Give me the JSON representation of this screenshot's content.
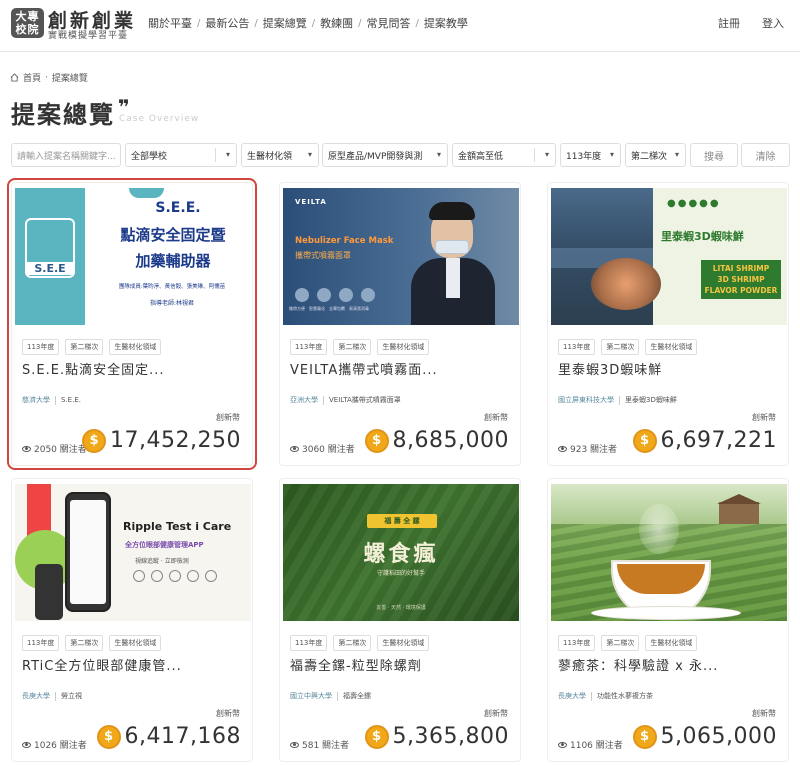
{
  "logo": {
    "box_text": "大專校院",
    "title": "創新創業",
    "subtitle": "實戰模擬學習平臺"
  },
  "nav": [
    "關於平臺",
    "最新公告",
    "提案總覽",
    "教練團",
    "常見問答",
    "提案教學"
  ],
  "auth": {
    "register": "註冊",
    "login": "登入"
  },
  "breadcrumb": {
    "home": "首頁",
    "sep": "·",
    "current": "提案總覽"
  },
  "page": {
    "title": "提案總覽",
    "quote": "❞",
    "subtitle": "Case Overview"
  },
  "filters": {
    "search_placeholder": "請輸入提案名稱關鍵字...",
    "school": "全部學校",
    "field": "生醫材化領",
    "stage": "原型產品/MVP開發與測",
    "sort": "金額高至低",
    "year": "113年度",
    "batch": "第二梯次",
    "search_button": "搜尋",
    "clear_button": "清除"
  },
  "currency_label": "創新幣",
  "coin_glyph": "$",
  "cards": [
    {
      "tags": [
        "113年度",
        "第二梯次",
        "生醫材化領域"
      ],
      "title": "S.E.E.點滴安全固定...",
      "school": "慈濟大學",
      "team": "S.E.E.",
      "followers": "2050 關注者",
      "amount": "17,452,250",
      "thumb": {
        "title1": "S.E.E.",
        "title2": "點滴安全固定暨",
        "title3": "加藥輔助器",
        "members": "團隊成員:葉昀淨、黃信毅、張美琳、阿儒苗",
        "advisor": "指導老師:林視君",
        "logo": "S.E.E"
      }
    },
    {
      "tags": [
        "113年度",
        "第二梯次",
        "生醫材化領域"
      ],
      "title": "VEILTA攜帶式噴霧面...",
      "school": "亞洲大學",
      "team": "VEILTA攜帶式噴霧面罩",
      "followers": "3060 關注者",
      "amount": "8,685,000",
      "thumb": {
        "brand": "VEILTA",
        "title_en": "Nebulizer Face Mask",
        "title_zh": "攜帶式噴霧面罩",
        "icons": [
          "攜帶方便",
          "智慧霧化",
          "全罩包覆",
          "易清潔消毒"
        ]
      }
    },
    {
      "tags": [
        "113年度",
        "第二梯次",
        "生醫材化領域"
      ],
      "title": "里泰蝦3D蝦味鮮",
      "school": "國立屏東科技大學",
      "team": "里泰蝦3D蝦味鮮",
      "followers": "923 關注者",
      "amount": "6,697,221",
      "thumb": {
        "title": "里泰蝦3D蝦味鮮",
        "en1": "LITAI SHRIMP",
        "en2": "3D SHRIMP",
        "en3": "FLAVOR POWDER"
      }
    },
    {
      "tags": [
        "113年度",
        "第二梯次",
        "生醫材化領域"
      ],
      "title": "RTiC全方位眼部健康管...",
      "school": "長庚大學",
      "team": "勞立視",
      "followers": "1026 關注者",
      "amount": "6,417,168",
      "thumb": {
        "title": "Ripple Test i Care",
        "subtitle": "全方位眼部健康管理APP",
        "line": "視線追蹤 · 立即檢測"
      }
    },
    {
      "tags": [
        "113年度",
        "第二梯次",
        "生醫材化領域"
      ],
      "title": "福壽全鏍-粒型除螺劑",
      "school": "國立中興大學",
      "team": "福壽全鏍",
      "followers": "581 關注者",
      "amount": "5,365,800",
      "thumb": {
        "badge": "福 壽 全 鏍",
        "title": "螺食瘋",
        "subtitle": "守護稻田的好幫手",
        "foot": "友善 · 天然 · 環境保護"
      }
    },
    {
      "tags": [
        "113年度",
        "第二梯次",
        "生醫材化領域"
      ],
      "title": "蓼癒茶：科學驗證 x 永...",
      "school": "長庚大學",
      "team": "功能性水蓼複方茶",
      "followers": "1106 關注者",
      "amount": "5,065,000",
      "thumb": {}
    }
  ]
}
